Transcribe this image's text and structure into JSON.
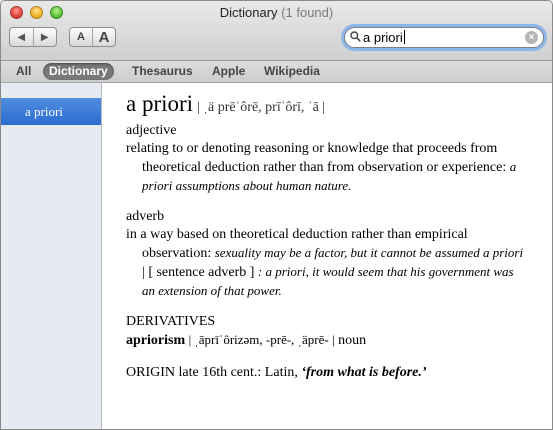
{
  "window": {
    "title": "Dictionary",
    "found": "(1 found)"
  },
  "toolbar": {
    "back_label": "◀",
    "forward_label": "▶",
    "font_smaller_label": "A",
    "font_larger_label": "A"
  },
  "search": {
    "value": "a priori",
    "clear_label": "×"
  },
  "scopes": [
    {
      "label": "All",
      "active": false
    },
    {
      "label": "Dictionary",
      "active": true
    },
    {
      "label": "Thesaurus",
      "active": false
    },
    {
      "label": "Apple",
      "active": false
    },
    {
      "label": "Wikipedia",
      "active": false
    }
  ],
  "sidebar": {
    "items": [
      {
        "label": "a priori"
      }
    ]
  },
  "entry": {
    "headword": "a priori",
    "pronunciation": "| ˌä prēˈôrē,   prīˈôrī,   ˈā |",
    "sense1": {
      "pos": "adjective",
      "definition": "relating to or denoting reasoning or knowledge that proceeds from theoretical deduction rather than from observation or experience:",
      "example": "a priori assumptions about human nature."
    },
    "sense2": {
      "pos": "adverb",
      "definition": "in a way based on theoretical deduction rather than empirical observation:",
      "example": "sexuality may be a factor, but it cannot be assumed a priori",
      "sep": "|",
      "label": "[ sentence adverb ]",
      "example2": ": a priori, it would seem that his government was an extension of  that power."
    },
    "derivatives": {
      "heading": "DERIVATIVES",
      "word": "apriorism",
      "pronunciation": "| ˌāprīˈôrizəm,   -prē-,   ˌäprē- |",
      "pos": "noun"
    },
    "origin": {
      "label": "ORIGIN late 16th cent.: Latin,",
      "quote": "‘from what is before.’"
    }
  }
}
